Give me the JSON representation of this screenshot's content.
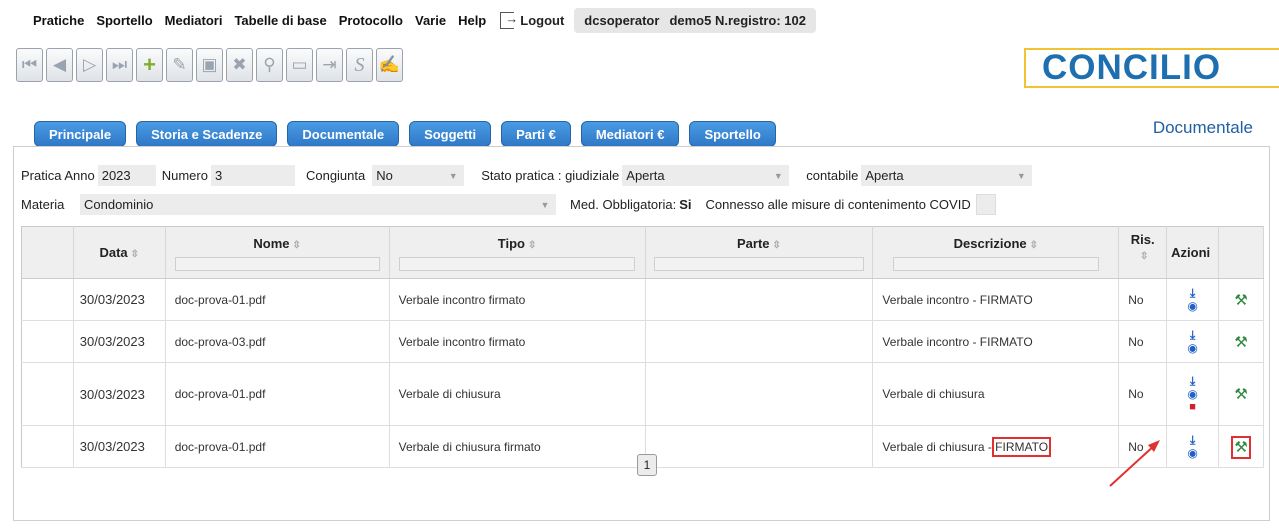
{
  "menu": {
    "items": [
      "Pratiche",
      "Sportello",
      "Mediatori",
      "Tabelle di base",
      "Protocollo",
      "Varie",
      "Help"
    ],
    "logout": "Logout",
    "user": "dcsoperator",
    "tenant": "demo5 N.registro: 102"
  },
  "logo": "CONCILIO",
  "toolbar": {
    "icons": [
      "first-icon",
      "prev-icon",
      "next-icon",
      "last-icon",
      "add-icon",
      "edit-icon",
      "save-icon",
      "delete-icon",
      "search-icon",
      "monitor-icon",
      "export-icon",
      "s-icon",
      "signature-icon"
    ]
  },
  "tabs": [
    "Principale",
    "Storia e Scadenze",
    "Documentale",
    "Soggetti",
    "Parti €",
    "Mediatori €",
    "Sportello"
  ],
  "section_title": "Documentale",
  "info": {
    "anno_label": "Pratica Anno",
    "anno": "2023",
    "numero_label": "Numero",
    "numero": "3",
    "congiunta_label": "Congiunta",
    "congiunta": "No",
    "stato_label": "Stato pratica : giudiziale",
    "stato": "Aperta",
    "contabile_label": "contabile",
    "contabile": "Aperta",
    "materia_label": "Materia",
    "materia": "Condominio",
    "obbl_label": "Med. Obbligatoria:",
    "obbl": "Si",
    "covid_label": "Connesso alle misure di contenimento COVID"
  },
  "table": {
    "headers": {
      "data": "Data",
      "nome": "Nome",
      "tipo": "Tipo",
      "parte": "Parte",
      "descrizione": "Descrizione",
      "ris": "Ris.",
      "azioni": "Azioni"
    },
    "rows": [
      {
        "data": "30/03/2023",
        "nome": "doc-prova-01.pdf",
        "tipo": "Verbale incontro firmato",
        "parte": "",
        "descrizione": "Verbale incontro - FIRMATO",
        "ris": "No"
      },
      {
        "data": "30/03/2023",
        "nome": "doc-prova-03.pdf",
        "tipo": "Verbale incontro firmato",
        "parte": "",
        "descrizione": "Verbale incontro - FIRMATO",
        "ris": "No"
      },
      {
        "data": "30/03/2023",
        "nome": "doc-prova-01.pdf",
        "tipo": "Verbale di chiusura",
        "parte": "",
        "descrizione": "Verbale di chiusura",
        "ris": "No"
      },
      {
        "data": "30/03/2023",
        "nome": "doc-prova-01.pdf",
        "tipo": "Verbale di chiusura firmato",
        "parte": "",
        "descrizione_prefix": "Verbale di chiusura -",
        "descrizione_highlight": "FIRMATO",
        "ris": "No"
      }
    ]
  },
  "pager": "1",
  "colors": {
    "tab": "#2f78c7",
    "highlight": "#e03030",
    "hammer": "#2a8a3a",
    "download": "#1f5fc7"
  }
}
